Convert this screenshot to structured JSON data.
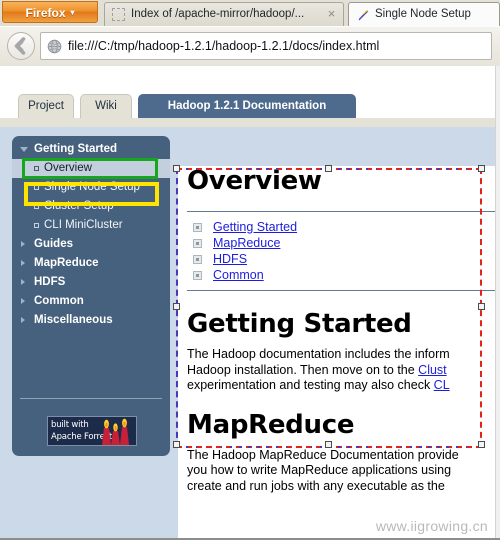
{
  "browser": {
    "app_button": {
      "label": "Firefox",
      "caret": "▾"
    },
    "tabs": [
      {
        "title": "Index of /apache-mirror/hadoop/...",
        "icon": "blank-favicon",
        "active": false,
        "closable": true,
        "close_glyph": "×"
      },
      {
        "title": "Single Node Setup",
        "icon": "pencil-favicon",
        "active": true,
        "closable": false,
        "close_glyph": ""
      }
    ],
    "back_button_icon": "back-arrow-icon",
    "url_icon": "globe-icon",
    "url": "file:///C:/tmp/hadoop-1.2.1/hadoop-1.2.1/docs/index.html"
  },
  "page": {
    "tabs": [
      {
        "label": "Project",
        "active": false
      },
      {
        "label": "Wiki",
        "active": false
      },
      {
        "label": "Hadoop 1.2.1 Documentation",
        "active": true
      }
    ],
    "sidebar": {
      "items": [
        {
          "label": "Getting Started",
          "level": "top",
          "expanded": true,
          "selected": false
        },
        {
          "label": "Overview",
          "level": "sub",
          "expanded": false,
          "selected": true
        },
        {
          "label": "Single Node Setup",
          "level": "sub",
          "expanded": false,
          "selected": false
        },
        {
          "label": "Cluster Setup",
          "level": "sub",
          "expanded": false,
          "selected": false
        },
        {
          "label": "CLI MiniCluster",
          "level": "sub",
          "expanded": false,
          "selected": false
        },
        {
          "label": "Guides",
          "level": "top",
          "expanded": false,
          "selected": false
        },
        {
          "label": "MapReduce",
          "level": "top",
          "expanded": false,
          "selected": false
        },
        {
          "label": "HDFS",
          "level": "top",
          "expanded": false,
          "selected": false
        },
        {
          "label": "Common",
          "level": "top",
          "expanded": false,
          "selected": false
        },
        {
          "label": "Miscellaneous",
          "level": "top",
          "expanded": false,
          "selected": false
        }
      ],
      "badge": {
        "line1": "built with",
        "line2": "Apache Forrest",
        "icon": "forrest-candles-icon"
      }
    },
    "content": {
      "heading_overview": "Overview",
      "minitoc": [
        {
          "label": "Getting Started"
        },
        {
          "label": "MapReduce"
        },
        {
          "label": "HDFS"
        },
        {
          "label": "Common"
        }
      ],
      "heading_getting_started": "Getting Started",
      "gs_lines": [
        {
          "text": "The Hadoop documentation includes the inform",
          "link": ""
        },
        {
          "text": "Hadoop installation. Then move on to the ",
          "link": "Clust"
        },
        {
          "text": "experimentation and testing may also check ",
          "link": "CL"
        }
      ],
      "heading_mapreduce": "MapReduce",
      "mr_lines": [
        "The Hadoop MapReduce Documentation provide",
        "you how to write MapReduce applications using",
        "create and run jobs with any executable as the"
      ]
    },
    "watermark": "www.iigrowing.cn"
  },
  "annotations": {
    "green_box_target": "Overview",
    "yellow_box_target": "Single Node Setup",
    "selection_box_target": "document-content-selection"
  },
  "colors": {
    "sidebar_bg": "#46617d",
    "active_tab_bg": "#4e6b8e",
    "content_bg": "#ccd9e8",
    "link": "#1d1ddd",
    "green_highlight": "#16a81c",
    "yellow_highlight": "#ffe400",
    "selection_red": "#e2231a",
    "firefox_orange": "#ef912c"
  }
}
